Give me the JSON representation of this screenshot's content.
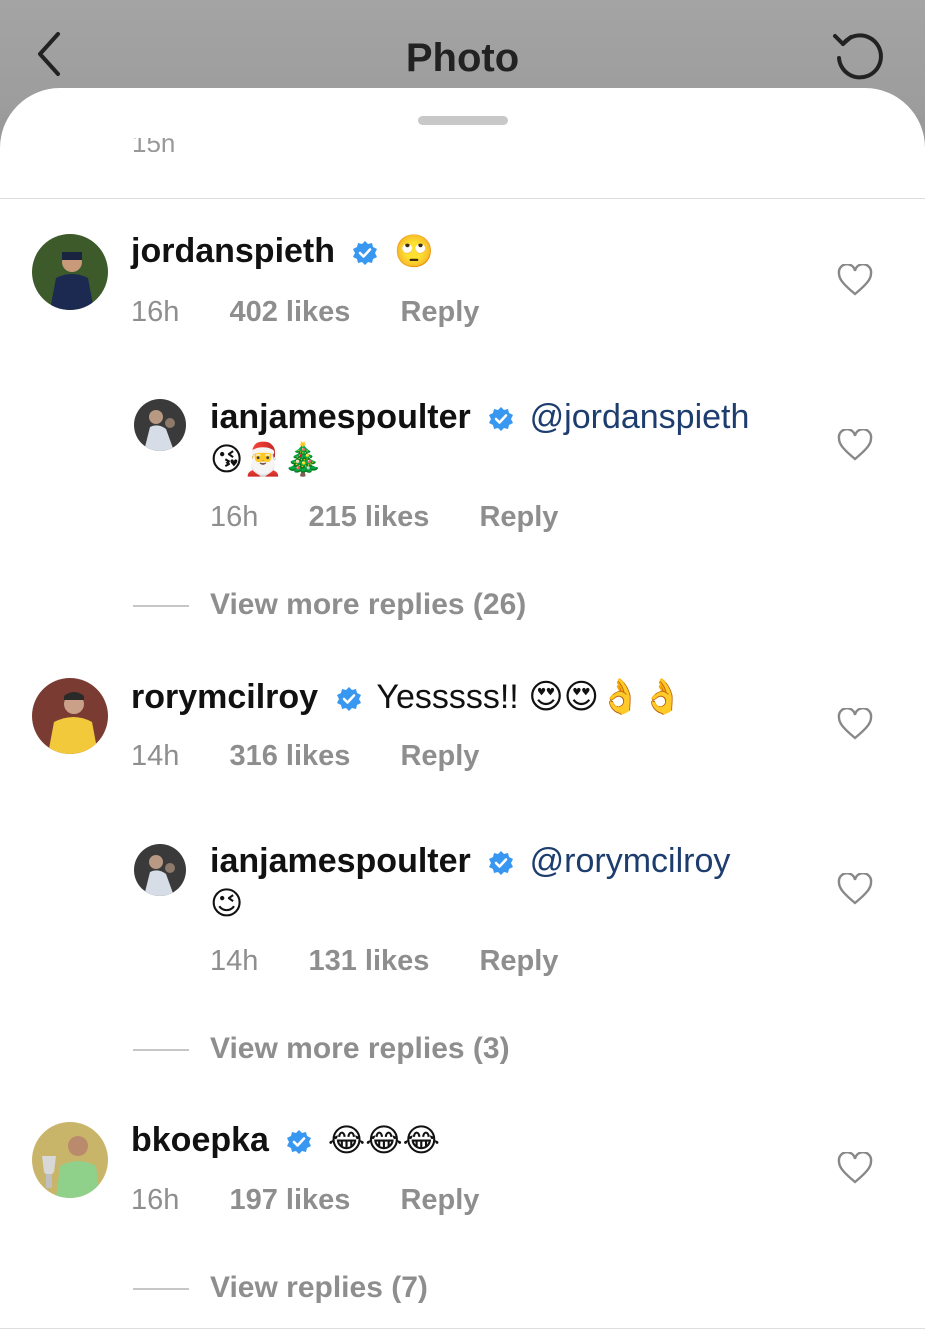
{
  "header": {
    "title": "Photo"
  },
  "sheet": {
    "cut_off_text": "15h"
  },
  "comments": [
    {
      "user": "jordanspieth",
      "text": "🙄",
      "time": "16h",
      "likes": "402 likes",
      "reply": "Reply"
    },
    {
      "user": "ianjamespoulter",
      "mention": "@jordanspieth",
      "text2": "😘🎅🎄",
      "time": "16h",
      "likes": "215 likes",
      "reply": "Reply"
    },
    {
      "user": "rorymcilroy",
      "text": "Yesssss!! 😍😍👌👌",
      "time": "14h",
      "likes": "316 likes",
      "reply": "Reply"
    },
    {
      "user": "ianjamespoulter",
      "mention": "@rorymcilroy",
      "text2": "😉",
      "time": "14h",
      "likes": "131 likes",
      "reply": "Reply"
    },
    {
      "user": "bkoepka",
      "text": "😂😂😂",
      "time": "16h",
      "likes": "197 likes",
      "reply": "Reply"
    }
  ],
  "more_replies": [
    "View more replies (26)",
    "View more replies (3)",
    "View replies (7)"
  ],
  "colors": {
    "verified": "#3897f0",
    "mention": "#1c3d6e",
    "meta": "#8e8e8e"
  }
}
